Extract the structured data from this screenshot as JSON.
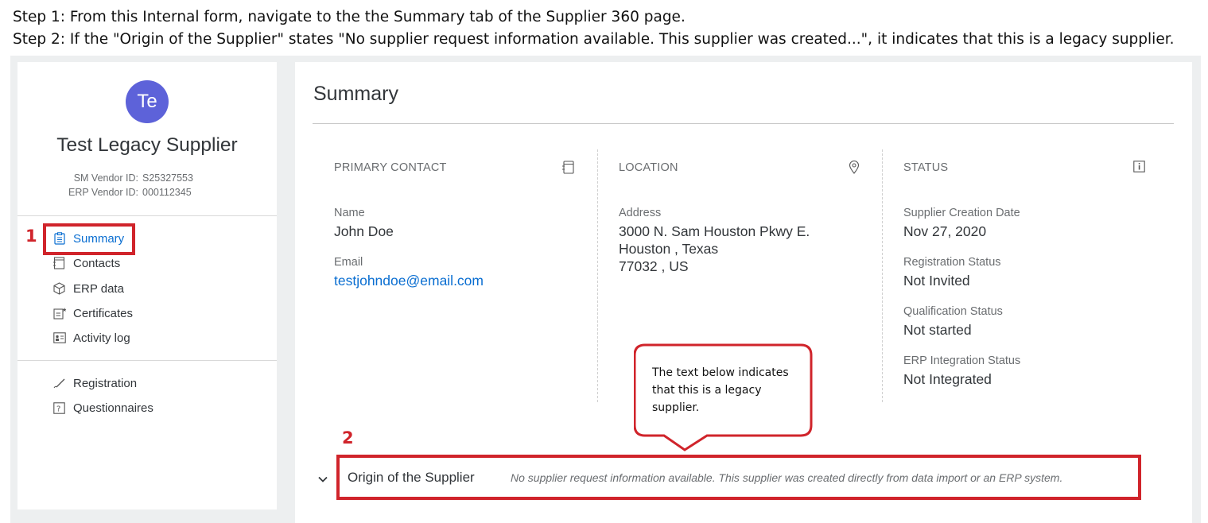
{
  "instructions": {
    "step1": "Step 1: From this Internal form, navigate to the the Summary tab of the Supplier 360 page.",
    "step2": "Step 2: If the \"Origin of the Supplier\" states \"No supplier request information available. This supplier was created...\", it indicates that this is a legacy supplier."
  },
  "supplier": {
    "avatar_initials": "Te",
    "avatar_color": "#5d62d9",
    "name": "Test Legacy Supplier",
    "sm_vendor_label": "SM Vendor ID:",
    "sm_vendor_id": "S25327553",
    "erp_vendor_label": "ERP Vendor ID:",
    "erp_vendor_id": "000112345"
  },
  "nav": {
    "items": [
      {
        "label": "Summary",
        "icon": "clipboard-icon",
        "active": true
      },
      {
        "label": "Contacts",
        "icon": "contact-card-icon",
        "active": false
      },
      {
        "label": "ERP data",
        "icon": "cube-icon",
        "active": false
      },
      {
        "label": "Certificates",
        "icon": "certificate-icon",
        "active": false
      },
      {
        "label": "Activity log",
        "icon": "activity-log-icon",
        "active": false
      }
    ],
    "secondary": [
      {
        "label": "Registration",
        "icon": "pen-icon"
      },
      {
        "label": "Questionnaires",
        "icon": "question-icon"
      }
    ]
  },
  "summary": {
    "title": "Summary",
    "primary_contact": {
      "heading": "PRIMARY CONTACT",
      "name_label": "Name",
      "name": "John Doe",
      "email_label": "Email",
      "email": "testjohndoe@email.com"
    },
    "location": {
      "heading": "LOCATION",
      "address_label": "Address",
      "line1": "3000 N. Sam Houston Pkwy E.",
      "line2": "Houston , Texas",
      "line3": "77032 , US"
    },
    "status": {
      "heading": "STATUS",
      "creation_label": "Supplier Creation Date",
      "creation_value": "Nov 27, 2020",
      "registration_label": "Registration Status",
      "registration_value": "Not Invited",
      "qualification_label": "Qualification Status",
      "qualification_value": "Not started",
      "erp_label": "ERP Integration Status",
      "erp_value": "Not Integrated"
    }
  },
  "origin": {
    "label": "Origin of the Supplier",
    "text": "No supplier request information available. This supplier was created directly from data import or an ERP system."
  },
  "annotations": {
    "marker1": "1",
    "marker2": "2",
    "callout": "The text below indicates that this is a legacy supplier.",
    "highlight_color": "#d0242b"
  }
}
